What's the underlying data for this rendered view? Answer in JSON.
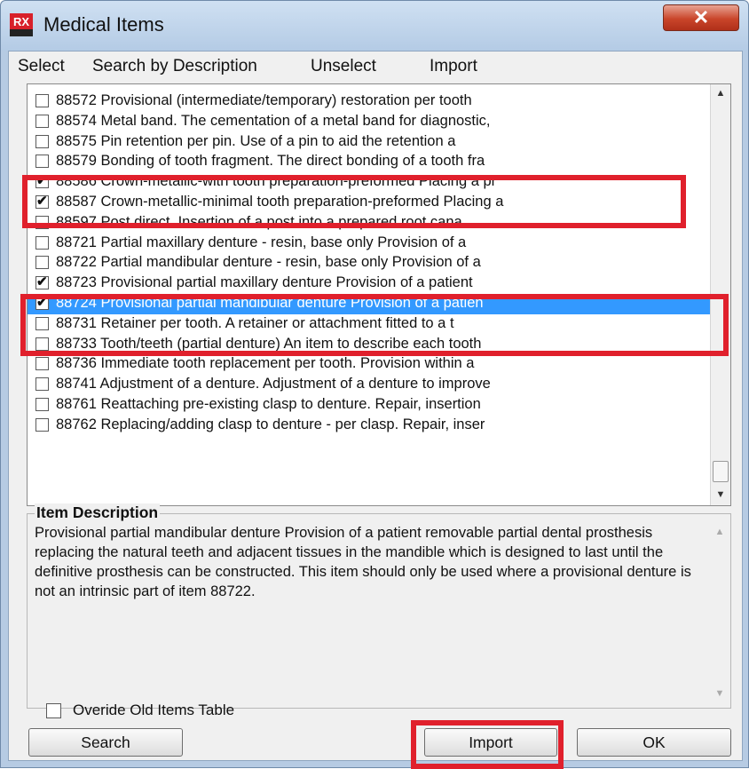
{
  "window": {
    "title": "Medical Items",
    "close_glyph": "✕"
  },
  "menu": [
    {
      "label": "Select"
    },
    {
      "label": "Search by Description"
    },
    {
      "label": "Unselect"
    },
    {
      "label": "Import"
    }
  ],
  "items": [
    {
      "text": "88572 Provisional (intermediate/temporary) restoration   per tooth",
      "checked": false,
      "selected": false
    },
    {
      "text": "88574 Metal band. The cementation of a metal band for diagnostic,",
      "checked": false,
      "selected": false
    },
    {
      "text": "88575 Pin retention   per pin. Use of a pin to aid the retention a",
      "checked": false,
      "selected": false
    },
    {
      "text": "88579 Bonding of tooth fragment. The direct bonding of a tooth fra",
      "checked": false,
      "selected": false
    },
    {
      "text": "88586 Crown-metallic-with tooth preparation-preformed Placing a pr",
      "checked": true,
      "selected": false
    },
    {
      "text": "88587 Crown-metallic-minimal tooth preparation-preformed Placing a",
      "checked": true,
      "selected": false
    },
    {
      "text": "88597 Post   direct. Insertion of a post into a prepared root cana",
      "checked": false,
      "selected": false
    },
    {
      "text": "88721 Partial maxillary denture - resin, base only Provision of a",
      "checked": false,
      "selected": false
    },
    {
      "text": "88722 Partial mandibular denture - resin, base only Provision of a",
      "checked": false,
      "selected": false
    },
    {
      "text": "88723 Provisional partial maxillary denture Provision of a patient",
      "checked": true,
      "selected": false
    },
    {
      "text": "88724 Provisional partial mandibular denture Provision of a patien",
      "checked": true,
      "selected": true
    },
    {
      "text": "88731 Retainer   per tooth. A retainer or attachment fitted to a t",
      "checked": false,
      "selected": false
    },
    {
      "text": "88733 Tooth/teeth (partial denture) An item to describe each tooth",
      "checked": false,
      "selected": false
    },
    {
      "text": "88736 Immediate tooth replacement   per tooth. Provision within a",
      "checked": false,
      "selected": false
    },
    {
      "text": "88741 Adjustment of a denture. Adjustment of a denture to improve",
      "checked": false,
      "selected": false
    },
    {
      "text": "88761 Reattaching pre-existing clasp to denture. Repair, insertion",
      "checked": false,
      "selected": false
    },
    {
      "text": "88762 Replacing/adding clasp to denture - per clasp. Repair, inser",
      "checked": false,
      "selected": false
    }
  ],
  "description": {
    "legend": "Item Description",
    "text": "Provisional partial mandibular denture Provision of a patient removable partial dental prosthesis replacing the natural teeth and adjacent tissues in the mandible which is designed to last until the definitive prosthesis can be constructed. This item should only be used where a provisional denture is not an intrinsic part of item 88722."
  },
  "override": {
    "label": "Overide Old Items Table",
    "checked": false
  },
  "buttons": {
    "search": "Search",
    "import": "Import",
    "ok": "OK"
  },
  "highlight_color": "#e0202c",
  "selection_color": "#3399ff"
}
